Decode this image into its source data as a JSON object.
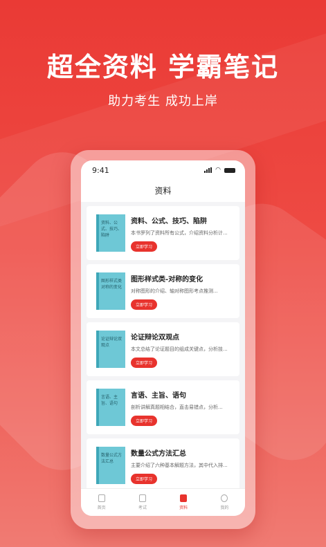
{
  "hero": {
    "title": "超全资料 学霸笔记",
    "subtitle": "助力考生 成功上岸"
  },
  "status_bar": {
    "time": "9:41"
  },
  "header": {
    "title": "资料"
  },
  "items": [
    {
      "cover": "资料、公式、技巧、陷阱",
      "title": "资料、公式、技巧、陷阱",
      "desc": "本书罗列了资料所有公式，介绍资料分析计...",
      "button": "立即学习"
    },
    {
      "cover": "图形样式类对称的变化",
      "title": "图形样式类-对称的变化",
      "desc": "对称图形的介绍、轴对称图形考点推测...",
      "button": "立即学习"
    },
    {
      "cover": "论证辩论双观点",
      "title": "论证辩论双观点",
      "desc": "本文总结了论证题目的组成关键点，分析技...",
      "button": "立即学习"
    },
    {
      "cover": "言语、主旨、语句",
      "title": "言语、主旨、语句",
      "desc": "剖析讲解真题相结合，直击易错点，分析...",
      "button": "立即学习"
    },
    {
      "cover": "数量公式方法汇总",
      "title": "数量公式方法汇总",
      "desc": "主要介绍了六种基本解题方法，其中代入排...",
      "button": "立即学习"
    }
  ],
  "tabs": [
    {
      "label": "首页",
      "icon": "home-icon"
    },
    {
      "label": "考试",
      "icon": "exam-icon"
    },
    {
      "label": "资料",
      "icon": "materials-icon",
      "active": true
    },
    {
      "label": "我的",
      "icon": "profile-icon"
    }
  ],
  "colors": {
    "accent": "#e8332d",
    "background_top": "#ea3a35",
    "book_cover": "#6ec8d6"
  }
}
